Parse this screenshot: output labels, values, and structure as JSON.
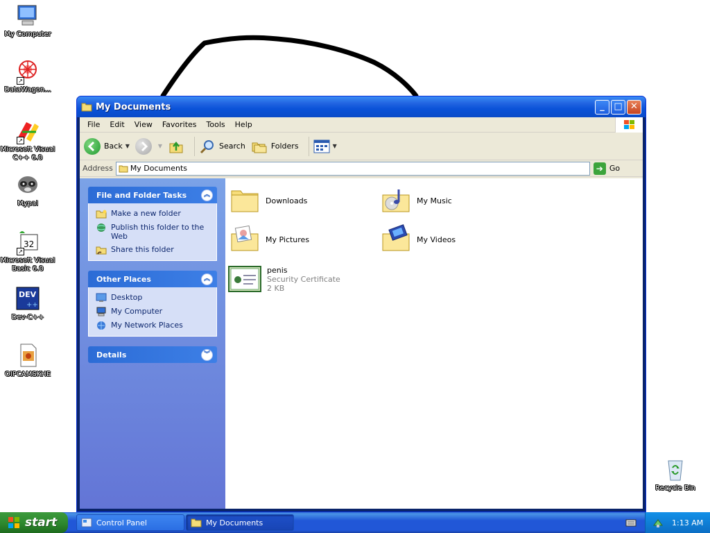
{
  "desktop": {
    "icons": [
      {
        "label": "My Computer"
      },
      {
        "label": "DataWagon..."
      },
      {
        "label": "Microsoft Visual C++ 6.0"
      },
      {
        "label": "Mypal"
      },
      {
        "label": "Microsoft Visual Basic 6.0"
      },
      {
        "label": "Dev-C++"
      },
      {
        "label": "OIPCAMSKHE"
      },
      {
        "label": "Recycle Bin"
      }
    ]
  },
  "window": {
    "title": "My Documents",
    "menu": [
      "File",
      "Edit",
      "View",
      "Favorites",
      "Tools",
      "Help"
    ],
    "toolbar": {
      "back": "Back",
      "search": "Search",
      "folders": "Folders"
    },
    "address": {
      "label": "Address",
      "value": "My Documents",
      "go": "Go"
    },
    "taskpane": {
      "file_tasks": {
        "title": "File and Folder Tasks",
        "links": [
          "Make a new folder",
          "Publish this folder to the Web",
          "Share this folder"
        ]
      },
      "other_places": {
        "title": "Other Places",
        "links": [
          "Desktop",
          "My Computer",
          "My Network Places"
        ]
      },
      "details": {
        "title": "Details"
      }
    },
    "items": [
      {
        "name": "Downloads"
      },
      {
        "name": "My Music"
      },
      {
        "name": "My Pictures"
      },
      {
        "name": "My Videos"
      },
      {
        "name": "penis",
        "type": "Security Certificate",
        "size": "2 KB"
      }
    ]
  },
  "taskbar": {
    "start": "start",
    "tasks": [
      "Control Panel",
      "My Documents"
    ],
    "clock": "1:13 AM"
  },
  "colors": {
    "xp_blue": "#0a52d8",
    "taskpane_blue": "#7ba2e7",
    "start_green": "#2f8a2f"
  }
}
